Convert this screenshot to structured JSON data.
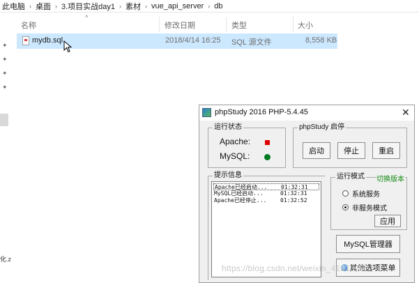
{
  "explorer": {
    "breadcrumb": [
      "此电脑",
      "桌面",
      "3.项目实战day1",
      "素材",
      "vue_api_server",
      "db"
    ],
    "columns": {
      "name": "名称",
      "date": "修改日期",
      "type": "类型",
      "size": "大小"
    },
    "files": [
      {
        "name": "mydb.sql",
        "date": "2018/4/14 16:25",
        "type": "SQL 源文件",
        "size": "8,558 KB"
      }
    ],
    "left_fragment": "化.z"
  },
  "phpstudy": {
    "title": "phpStudy 2016   PHP-5.4.45",
    "status_group": "运行状态",
    "apache_label": "Apache:",
    "mysql_label": "MySQL:",
    "control_group": "phpStudy 启停",
    "start_label": "启动",
    "stop_label": "停止",
    "restart_label": "重启",
    "log_group": "提示信息",
    "log": [
      {
        "msg": "Apache已经启动...",
        "time": "01:32:31"
      },
      {
        "msg": "MySQL已经启动...",
        "time": "01:32:31"
      },
      {
        "msg": "Apache已经停止...",
        "time": "01:32:52"
      }
    ],
    "mode_group": "运行模式",
    "switch_version": "切换版本",
    "mode_service": "系统服务",
    "mode_nonservice": "非服务模式",
    "apply_label": "应用",
    "mysql_manager_label": "MySQL管理器",
    "other_options_label": "其他选项菜单"
  },
  "watermark": "https://blog.csdn.net/weixin_4191009",
  "colors": {
    "selection": "#cce8ff",
    "apache_status": "#e00000",
    "mysql_status": "#007a1f",
    "switch_link": "#108a10"
  }
}
